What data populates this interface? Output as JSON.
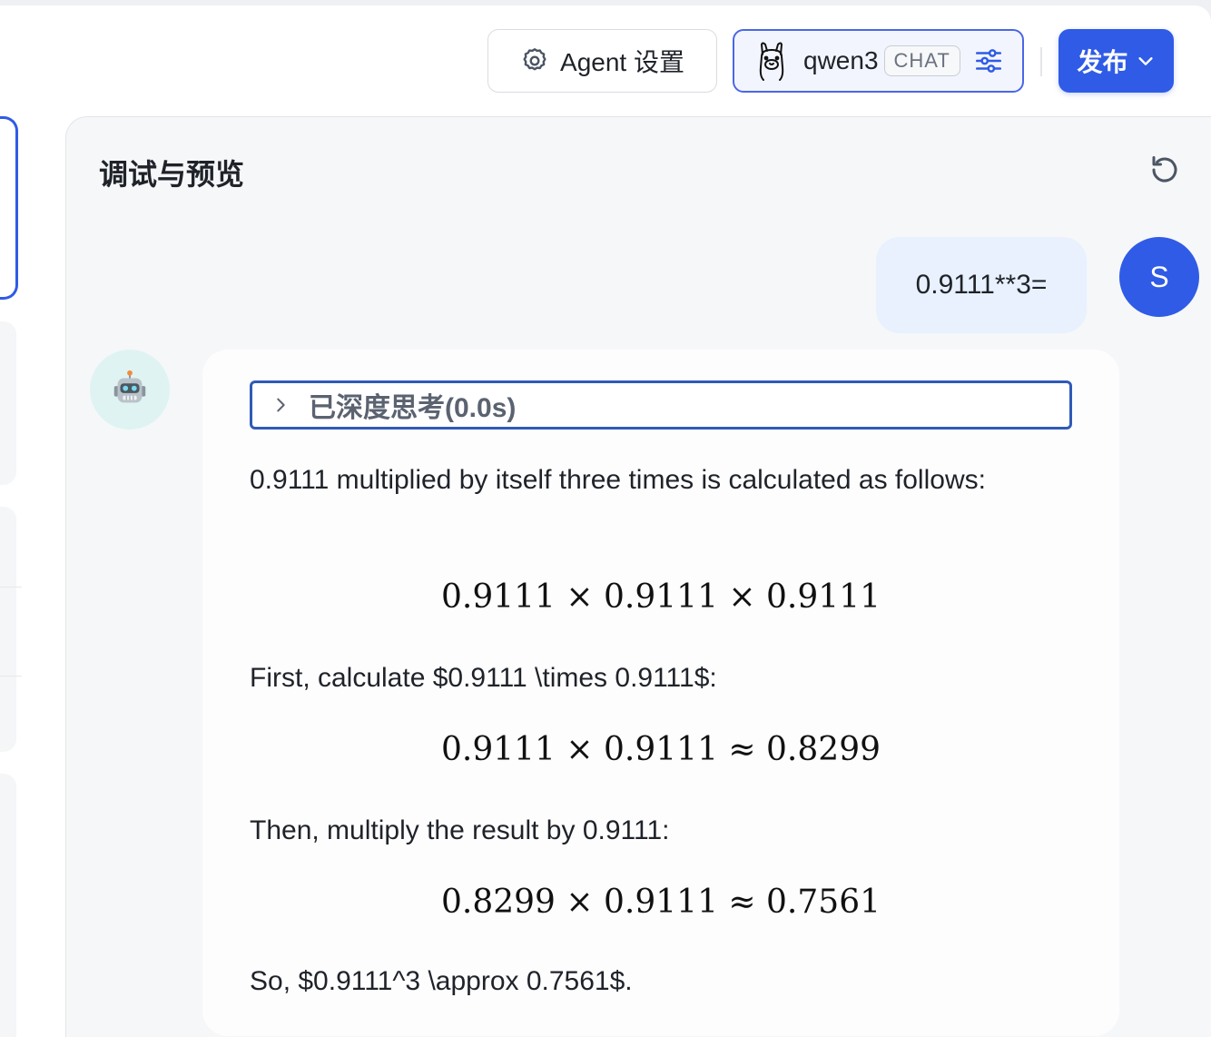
{
  "header": {
    "agent_settings_label": "Agent 设置",
    "model_name": "qwen3",
    "model_badge": "CHAT",
    "publish_label": "发布"
  },
  "panel": {
    "title": "调试与预览"
  },
  "conversation": {
    "user_message": "0.9111**3=",
    "user_avatar_letter": "S",
    "thinking_label": "已深度思考(0.0s)",
    "paragraphs": [
      "0.9111 multiplied by itself three times is calculated as follows:",
      "First, calculate $0.9111 \\times 0.9111$:",
      "Then, multiply the result by 0.9111:",
      "So, $0.9111^3 \\approx 0.7561$."
    ],
    "equations": [
      "0.9111 × 0.9111 × 0.9111",
      "0.9111 × 0.9111 ≈ 0.8299",
      "0.8299 × 0.9111 ≈ 0.7561"
    ]
  },
  "icons": {
    "agent_settings": "gear-icon",
    "model_logo": "llama-icon",
    "model_tune": "sliders-icon",
    "publish_dropdown": "chevron-down-icon",
    "refresh": "refresh-icon",
    "bot_avatar": "robot-icon",
    "thinking_toggle": "chevron-right-icon"
  },
  "colors": {
    "accent": "#2f5be6",
    "user_bubble": "#e8f1fd",
    "bot_avatar_bg": "#dff3f3"
  }
}
